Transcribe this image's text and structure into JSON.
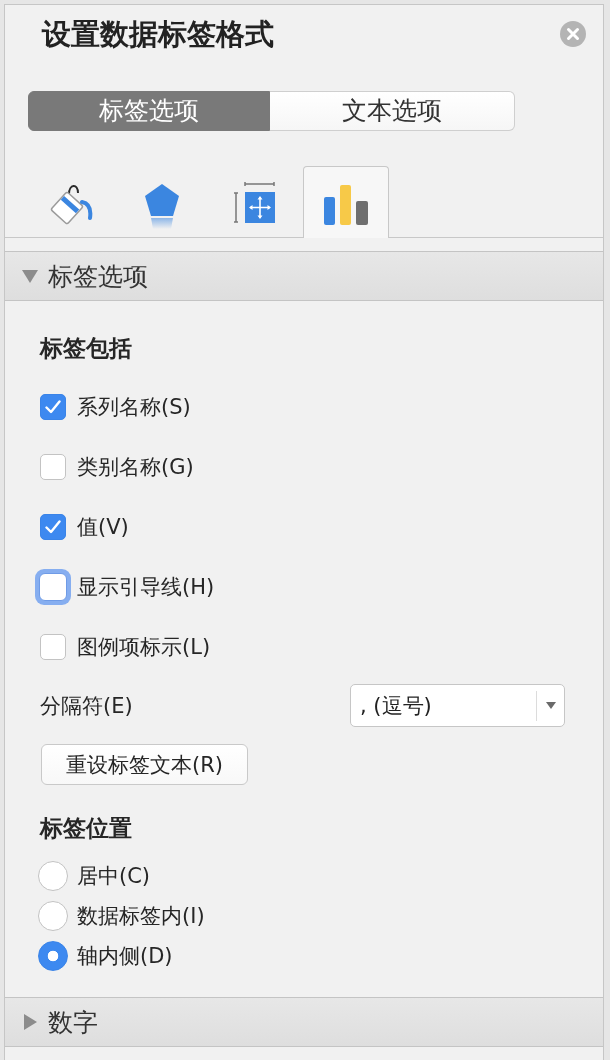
{
  "panel": {
    "title": "设置数据标签格式"
  },
  "option_tabs": [
    {
      "label": "标签选项",
      "selected": true
    },
    {
      "label": "文本选项",
      "selected": false
    }
  ],
  "icon_tabs": [
    {
      "kind": "fill",
      "selected": false
    },
    {
      "kind": "shape",
      "selected": false
    },
    {
      "kind": "size",
      "selected": false
    },
    {
      "kind": "chart",
      "selected": true
    }
  ],
  "sections": [
    {
      "title": "标签选项",
      "expanded": true,
      "content": {
        "include_heading": "标签包括",
        "checkboxes": [
          {
            "label": "系列名称(S)",
            "checked": true,
            "focused": false
          },
          {
            "label": "类别名称(G)",
            "checked": false,
            "focused": false
          },
          {
            "label": "值(V)",
            "checked": true,
            "focused": false
          },
          {
            "label": "显示引导线(H)",
            "checked": false,
            "focused": true
          },
          {
            "label": "图例项标示(L)",
            "checked": false,
            "focused": false
          }
        ],
        "separator": {
          "label": "分隔符(E)",
          "value": ", (逗号)"
        },
        "reset_button": "重设标签文本(R)",
        "position_heading": "标签位置",
        "positions": [
          {
            "label": "居中(C)",
            "selected": false
          },
          {
            "label": "数据标签内(I)",
            "selected": false
          },
          {
            "label": "轴内侧(D)",
            "selected": true
          }
        ]
      }
    },
    {
      "title": "数字",
      "expanded": false
    }
  ]
}
